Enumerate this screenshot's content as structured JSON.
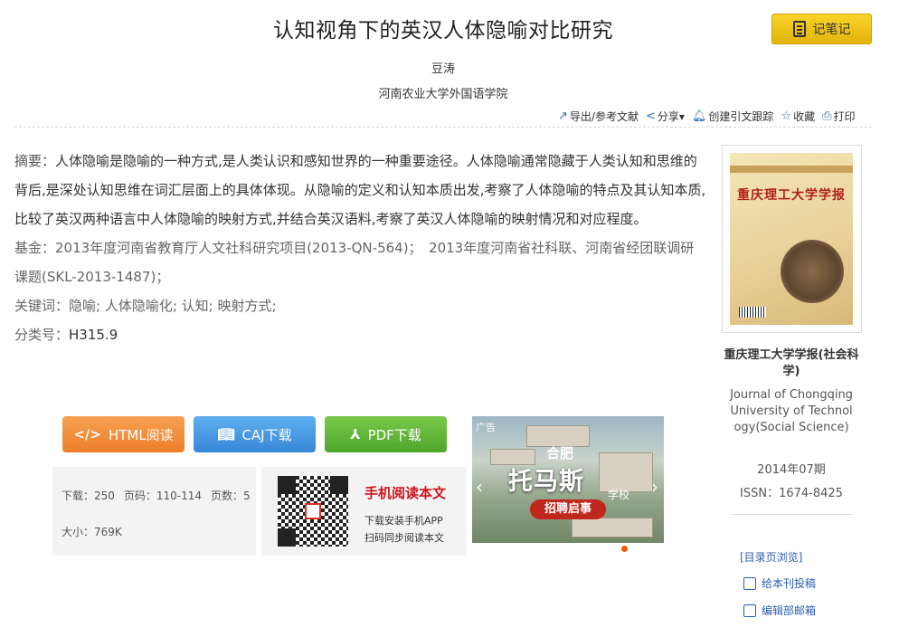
{
  "article": {
    "title": "认知视角下的英汉人体隐喻对比研究",
    "author": "豆涛",
    "organization": "河南农业大学外国语学院"
  },
  "note_button": "记笔记",
  "toolbar": {
    "export": "导出/参考文献",
    "share": "分享",
    "track": "创建引文跟踪",
    "favorite": "收藏",
    "print": "打印"
  },
  "abstract": {
    "label": "摘要：",
    "text": "人体隐喻是隐喻的一种方式,是人类认识和感知世界的一种重要途径。人体隐喻通常隐藏于人类认知和思维的背后,是深处认知思维在词汇层面上的具体体现。从隐喻的定义和认知本质出发,考察了人体隐喻的特点及其认知本质,比较了英汉两种语言中人体隐喻的映射方式,并结合英汉语料,考察了英汉人体隐喻的映射情况和对应程度。"
  },
  "fund": {
    "label": "基金：",
    "value": "2013年度河南省教育厅人文社科研究项目(2013-QN-564)；　2013年度河南省社科联、河南省经团联调研课题(SKL-2013-1487)；"
  },
  "keywords": {
    "label": "关键词：",
    "value": "隐喻; 人体隐喻化; 认知; 映射方式;"
  },
  "classification": {
    "label": "分类号：",
    "value": "H315.9"
  },
  "buttons": {
    "html": "HTML阅读",
    "caj": "CAJ下载",
    "pdf": "PDF下载"
  },
  "stats": {
    "downloads": "下载：250",
    "pages": "页码：110-114",
    "page_count": "页数：5",
    "size": "大小：769K"
  },
  "mobile": {
    "title": "手机阅读本文",
    "line1": "下载安装手机APP",
    "line2": "扫码同步阅读本文"
  },
  "ad": {
    "tag": "广告",
    "city": "合肥",
    "brand": "托马斯",
    "school": "学校",
    "recruit": "招聘启事"
  },
  "journal": {
    "cover_name": "重庆理工大学学报",
    "name_cn": "重庆理工大学学报(社会科学)",
    "name_en": "Journal of Chongqing University of Technology(Social Science)",
    "issue": "2014年07期",
    "issn": "ISSN：1674-8425",
    "toc_link": "[目录页浏览]",
    "submit": "给本刊投稿",
    "editor_mail": "编辑部邮箱"
  }
}
